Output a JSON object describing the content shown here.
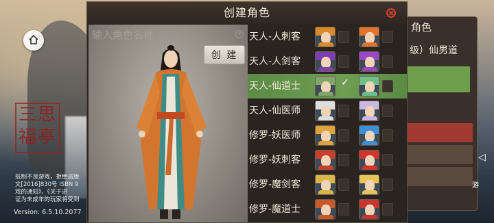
{
  "dialog": {
    "title": "创建角色"
  },
  "name_input": {
    "placeholder": "输入角色名称"
  },
  "create_label": "创 建",
  "classes": [
    {
      "name": "天人-人刺客",
      "selected": false,
      "male_hair": "#d98a2a",
      "female_hair": "#e0742e"
    },
    {
      "name": "天人-人剑客",
      "selected": false,
      "male_hair": "#7d3fb0",
      "female_hair": "#9a47c6"
    },
    {
      "name": "天人-仙道士",
      "selected": true,
      "male_hair": "#7fa56a",
      "female_hair": "#6fbf8c"
    },
    {
      "name": "天人-仙医师",
      "selected": false,
      "male_hair": "#dedede",
      "female_hair": "#c9b8e2"
    },
    {
      "name": "修罗-妖医师",
      "selected": false,
      "male_hair": "#e0a23c",
      "female_hair": "#3f8fd6"
    },
    {
      "name": "修罗-妖刺客",
      "selected": false,
      "male_hair": "#c8402c",
      "female_hair": "#d2352e"
    },
    {
      "name": "修罗-魔剑客",
      "selected": false,
      "male_hair": "#d8b64a",
      "female_hair": "#e6c45a"
    },
    {
      "name": "修罗-魔道士",
      "selected": false,
      "male_hair": "#c65a2a",
      "female_hair": "#c8342e"
    }
  ],
  "background": {
    "seal_text": "三思\n福亭",
    "notice_lines": [
      "抵制不良游戏，拒绝盗版",
      "文[2016]830号 ISBN 9",
      "戏的通知》、《关于进",
      "证为未成年的玩家将受到"
    ],
    "version": "Version:  6.5.10.2077"
  },
  "back_panel": {
    "title": "角色",
    "line": "级）仙男道",
    "side_text": "游"
  }
}
